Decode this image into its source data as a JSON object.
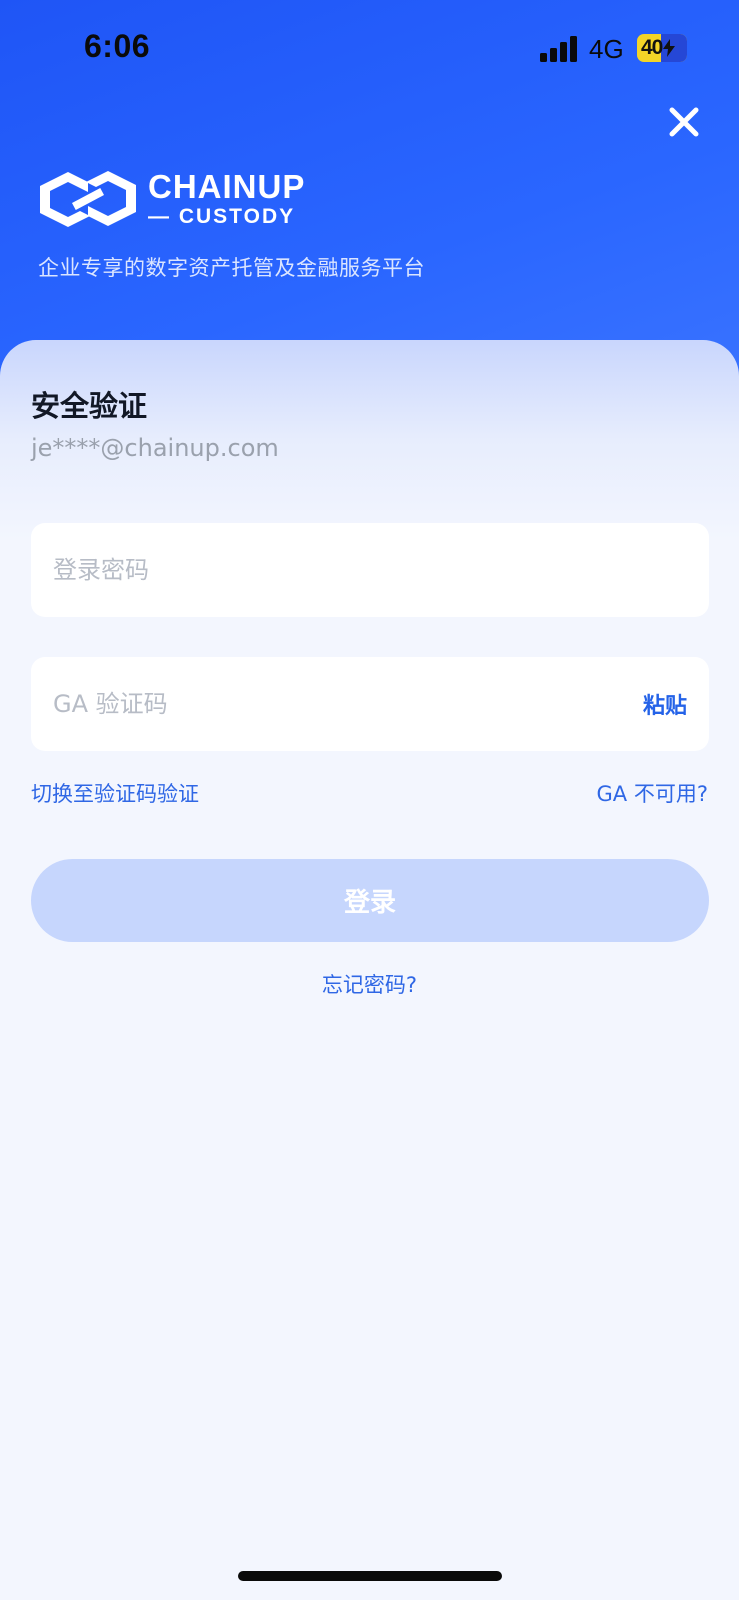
{
  "status_bar": {
    "time": "6:06",
    "network": "4G",
    "battery": "40"
  },
  "header": {
    "brand_top": "CHAINUP",
    "brand_bottom": "— CUSTODY",
    "tagline": "企业专享的数字资产托管及金融服务平台",
    "close_icon": "close-icon"
  },
  "form": {
    "title": "安全验证",
    "email": "je****@chainup.com",
    "password_placeholder": "登录密码",
    "ga_placeholder": "GA 验证码",
    "paste_label": "粘贴",
    "switch_link": "切换至验证码验证",
    "ga_unavailable_link": "GA 不可用?",
    "login_label": "登录",
    "forgot_link": "忘记密码?"
  },
  "colors": {
    "accent": "#2563e8",
    "header_bg": "#1f55f6",
    "login_disabled": "#c6d6fd",
    "battery_yellow": "#f3d427"
  }
}
